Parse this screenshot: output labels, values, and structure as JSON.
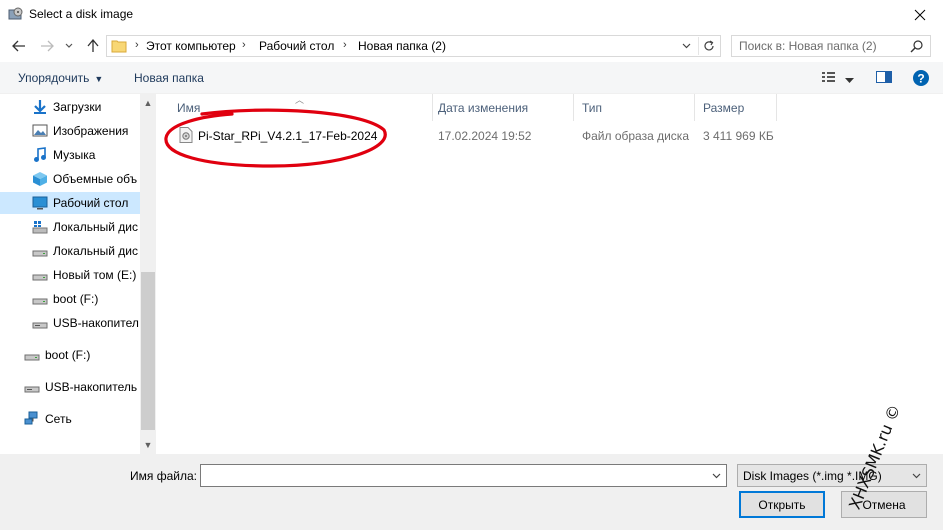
{
  "window": {
    "title": "Select a disk image",
    "icon": "disk-image-app-icon",
    "close_glyph": "✕"
  },
  "address_bar": {
    "breadcrumbs": [
      "Этот компьютер",
      "Рабочий стол",
      "Новая папка (2)"
    ],
    "separator": "›"
  },
  "search": {
    "placeholder": "Поиск в: Новая папка (2)"
  },
  "command_bar": {
    "organize_label": "Упорядочить",
    "new_folder_label": "Новая папка"
  },
  "nav_pane": {
    "items": [
      {
        "label": "Загрузки",
        "icon": "download-arrow-icon"
      },
      {
        "label": "Изображения",
        "icon": "pictures-icon"
      },
      {
        "label": "Музыка",
        "icon": "music-note-icon"
      },
      {
        "label": "Объемные объ",
        "icon": "3d-objects-icon"
      },
      {
        "label": "Рабочий стол",
        "icon": "desktop-icon",
        "selected": true
      },
      {
        "label": "Локальный дис",
        "icon": "windows-drive-icon"
      },
      {
        "label": "Локальный дис",
        "icon": "drive-icon"
      },
      {
        "label": "Новый том (E:)",
        "icon": "drive-icon"
      },
      {
        "label": "boot (F:)",
        "icon": "drive-icon"
      },
      {
        "label": "USB-накопител",
        "icon": "usb-drive-icon"
      },
      {
        "label": "boot (F:)",
        "icon": "drive-icon"
      },
      {
        "label": "USB-накопитель",
        "icon": "usb-drive-icon"
      },
      {
        "label": "Сеть",
        "icon": "network-icon"
      }
    ]
  },
  "columns": {
    "name": "Имя",
    "date": "Дата изменения",
    "type": "Тип",
    "size": "Размер"
  },
  "files": [
    {
      "name": "Pi-Star_RPi_V4.2.1_17-Feb-2024",
      "date": "17.02.2024 19:52",
      "type": "Файл образа диска",
      "size": "3 411 969 КБ",
      "highlight_color": "#e0000f"
    }
  ],
  "bottom": {
    "filename_label": "Имя файла:",
    "filename_value": "",
    "filter_value": "Disk Images (*.img *.IMG)",
    "open_label": "Открыть",
    "cancel_label": "Отмена"
  },
  "watermark": "XHXSMK.ru ©",
  "colors": {
    "selected_bg": "#cce8ff",
    "accent": "#0078d7",
    "header_text": "#4c607a",
    "help_badge": "#0063b1"
  }
}
